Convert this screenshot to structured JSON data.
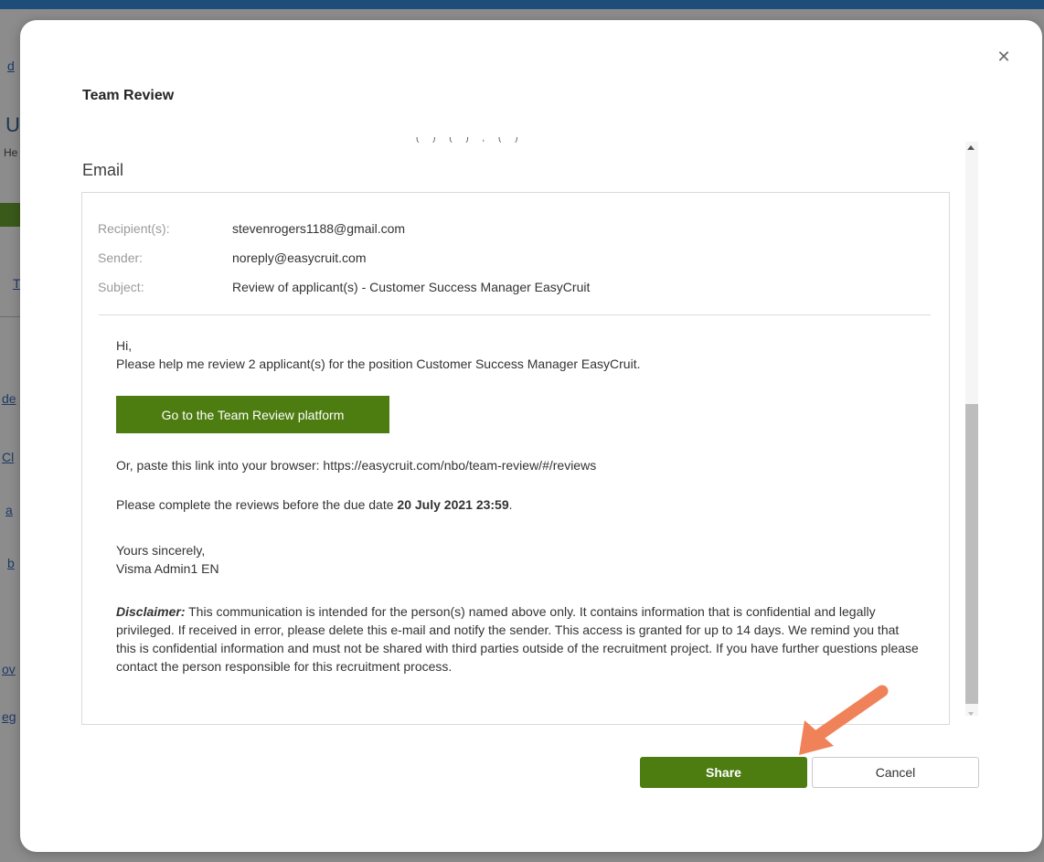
{
  "background": {
    "fragments": [
      "d",
      "U",
      "He",
      "T",
      "de",
      "Cl",
      "a",
      "b",
      "ov",
      "eg"
    ]
  },
  "modal": {
    "title": "Team Review",
    "close_icon": "close-icon",
    "section_heading": "Email",
    "cutoff_text": "( ) ( ) , ( )"
  },
  "email": {
    "recipient_label": "Recipient(s):",
    "recipient_value": "stevenrogers1188@gmail.com",
    "sender_label": "Sender:",
    "sender_value": "noreply@easycruit.com",
    "subject_label": "Subject:",
    "subject_value": "Review of applicant(s) - Customer Success Manager EasyCruit",
    "greeting": "Hi,",
    "intro": "Please help me review 2 applicant(s) for the position Customer Success Manager EasyCruit.",
    "cta_label": "Go to the Team Review platform",
    "link_line": "Or, paste this link into your browser: https://easycruit.com/nbo/team-review/#/reviews",
    "due_prefix": "Please complete the reviews before the due date ",
    "due_date": "20 July 2021 23:59",
    "due_suffix": ".",
    "closing": "Yours sincerely,",
    "signature": "Visma Admin1 EN",
    "disclaimer_label": "Disclaimer:",
    "disclaimer_text": " This communication is intended for the person(s) named above only. It contains information that is confidential and legally privileged. If received in error, please delete this e-mail and notify the sender. This access is granted for up to 14 days. We remind you that this is confidential information and must not be shared with third parties outside of the recruitment project. If you have further questions please contact the person responsible for this recruitment process."
  },
  "footer": {
    "share_label": "Share",
    "cancel_label": "Cancel"
  },
  "colors": {
    "accent_green": "#4d7c10",
    "annotation_arrow": "#f0825a",
    "topbar": "#1d4d78"
  }
}
